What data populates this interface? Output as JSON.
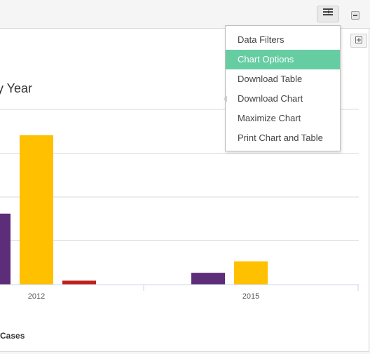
{
  "header": {
    "menu_icon": "menu-lines-icon",
    "collapse_icon": "minus-icon",
    "expand_icon": "plus-icon"
  },
  "chart_title": "by Year",
  "legend_text": "Cases",
  "menu": {
    "items": [
      {
        "label": "Data Filters",
        "active": false
      },
      {
        "label": "Chart Options",
        "active": true
      },
      {
        "label": "Download Table",
        "active": false
      },
      {
        "label": "Download Chart",
        "active": false
      },
      {
        "label": "Maximize Chart",
        "active": false
      },
      {
        "label": "Print Chart and Table",
        "active": false
      }
    ],
    "active_color": "#66cda3"
  },
  "chart_data": {
    "type": "bar",
    "categories": [
      "2012",
      "2015"
    ],
    "series": [
      {
        "color": "#5e2d79",
        "values": [
          162,
          27
        ]
      },
      {
        "color": "#ffc000",
        "values": [
          341,
          53
        ]
      },
      {
        "color": "#c0201a",
        "values": [
          9,
          null
        ]
      }
    ],
    "ylim": [
      0,
      400
    ],
    "grid": true
  }
}
